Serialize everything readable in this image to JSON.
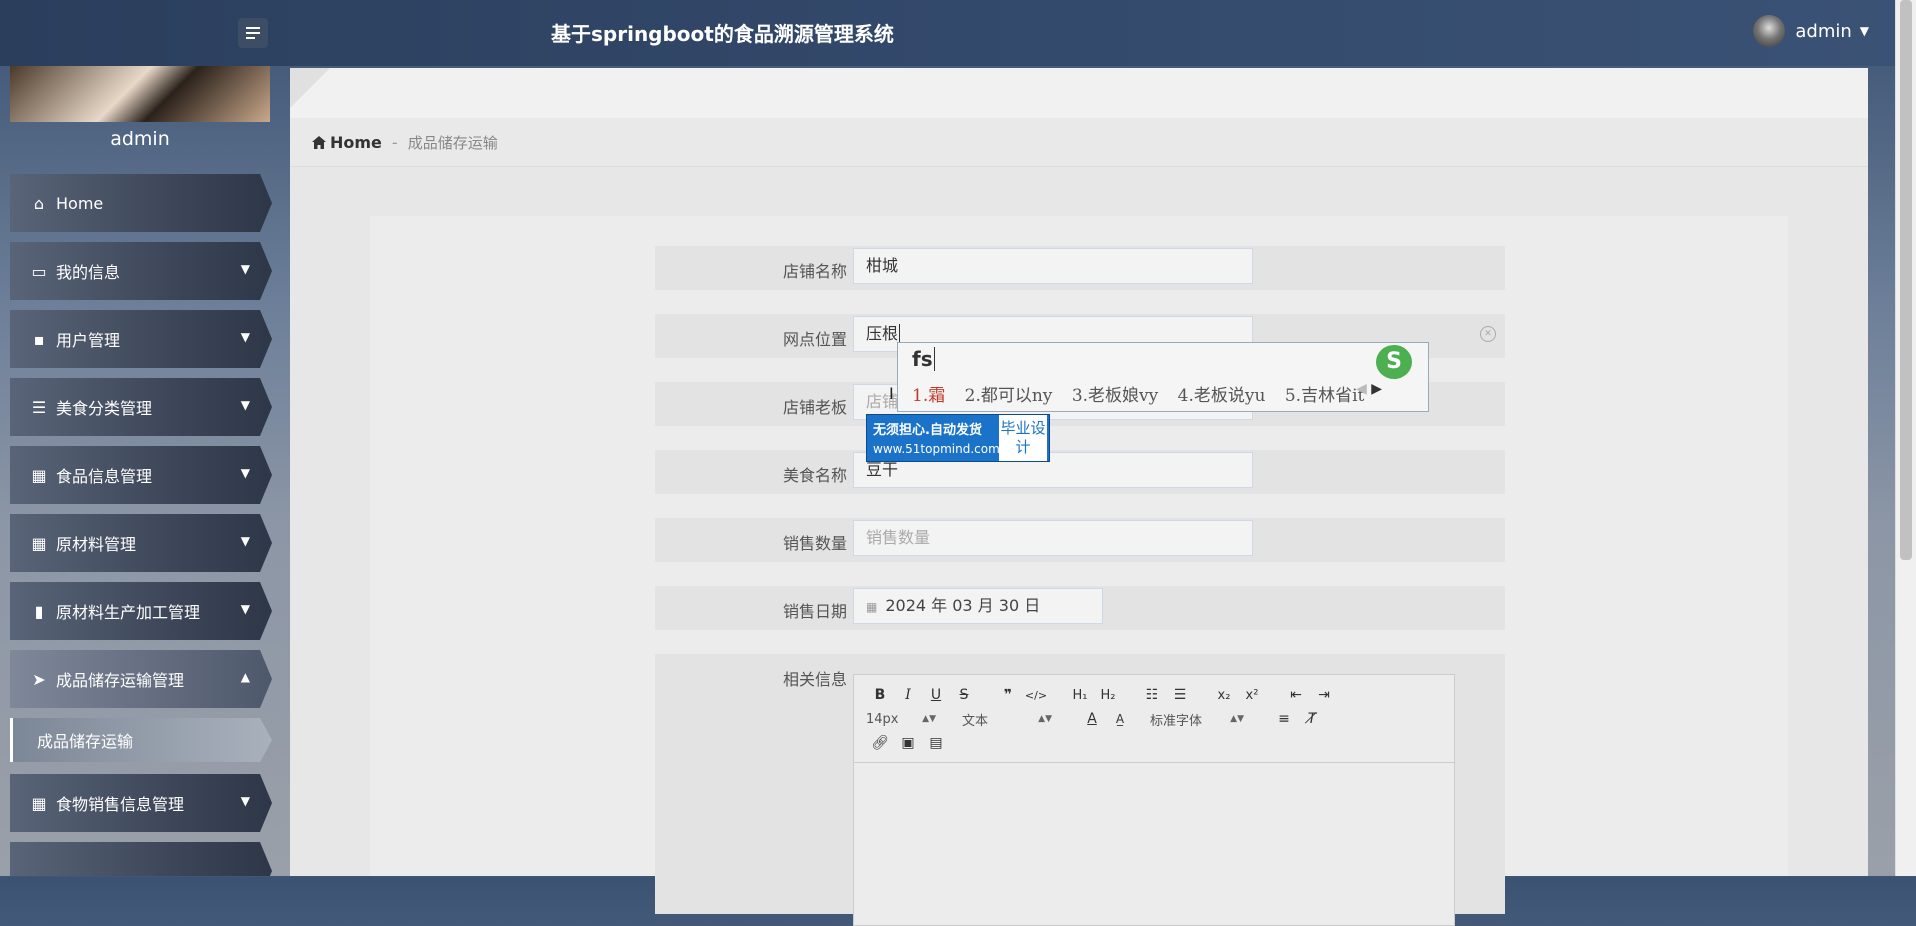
{
  "header": {
    "title": "基于springboot的食品溯源管理系统",
    "username": "admin"
  },
  "sidebar": {
    "profile_name": "admin",
    "items": [
      {
        "label": "Home"
      },
      {
        "label": "我的信息"
      },
      {
        "label": "用户管理"
      },
      {
        "label": "美食分类管理"
      },
      {
        "label": "食品信息管理"
      },
      {
        "label": "原材料管理"
      },
      {
        "label": "原材料生产加工管理"
      },
      {
        "label": "成品储存运输管理"
      },
      {
        "label": "食物销售信息管理"
      }
    ],
    "sub_item": "成品储存运输"
  },
  "breadcrumb": {
    "home": "Home",
    "separator": "-",
    "current": "成品储存运输"
  },
  "form": {
    "shop_name_label": "店铺名称",
    "shop_name_value": "柑城",
    "location_label": "网点位置",
    "location_value": "压根",
    "owner_label": "店铺老板",
    "owner_placeholder": "店铺",
    "food_name_label": "美食名称",
    "food_name_value": "豆干",
    "sales_qty_label": "销售数量",
    "sales_qty_placeholder": "销售数量",
    "sales_date_label": "销售日期",
    "sales_date_value": "2024 年 03 月 30 日",
    "info_label": "相关信息"
  },
  "editor": {
    "font_size": "14px",
    "text_type": "文本",
    "font_family": "标准字体"
  },
  "ime": {
    "typed": "fs",
    "candidates": [
      "1.霜",
      "2.都可以ny",
      "3.老板娘vy",
      "4.老板说yu",
      "5.吉林省it"
    ],
    "logo": "S"
  },
  "ad": {
    "line1": "无须担心.自动发货",
    "url": "www.51topmind.com",
    "right": "毕业设计"
  }
}
